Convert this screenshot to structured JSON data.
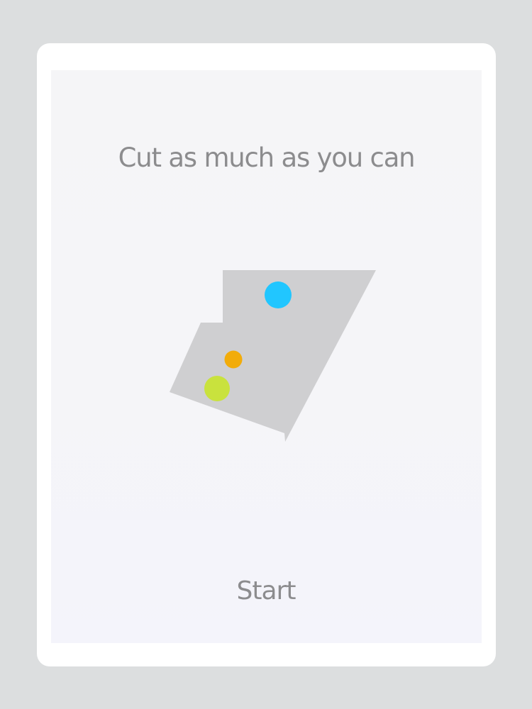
{
  "game": {
    "instruction": "Cut as much as you can",
    "start_label": "Start"
  },
  "colors": {
    "background": "#dcdedf",
    "frame": "#ffffff",
    "screen": "#f5f5f7",
    "shape_fill": "#cfcfd1",
    "text": "#8c8c8e",
    "ball_blue": "#21c6ff",
    "ball_orange": "#f2ac0a",
    "ball_green": "#c9e23d"
  },
  "balls": [
    {
      "color": "blue"
    },
    {
      "color": "orange"
    },
    {
      "color": "green"
    }
  ]
}
